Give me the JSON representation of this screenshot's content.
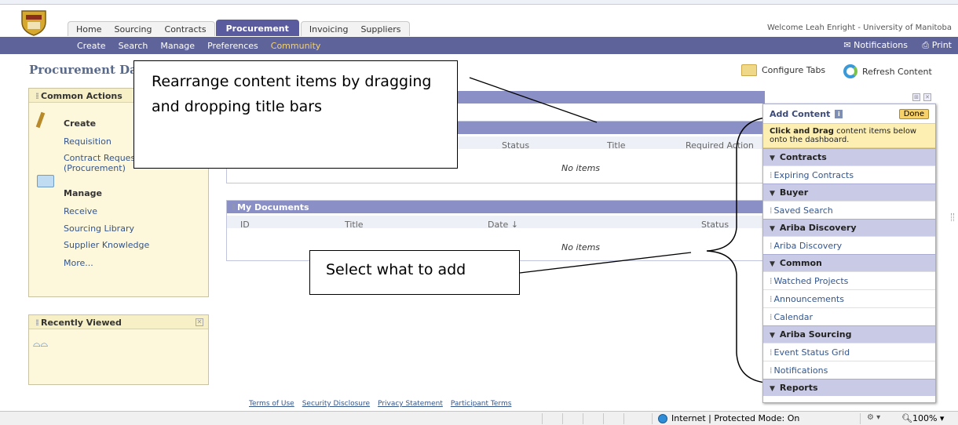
{
  "header": {
    "tabs": [
      "Home",
      "Sourcing",
      "Contracts",
      "Procurement",
      "Invoicing",
      "Suppliers"
    ],
    "active_tab": "Procurement",
    "welcome": "Welcome Leah Enright - University of Manitoba"
  },
  "subnav": {
    "items": [
      "Create",
      "Search",
      "Manage",
      "Preferences",
      "Community"
    ],
    "notifications": "Notifications",
    "print": "Print"
  },
  "page": {
    "title": "Procurement Da",
    "configure_tabs": "Configure Tabs",
    "refresh_content": "Refresh Content"
  },
  "common_actions": {
    "title": "Common Actions",
    "create_heading": "Create",
    "create_links": [
      "Requisition",
      "Contract Reques",
      "(Procurement)"
    ],
    "manage_heading": "Manage",
    "manage_links": [
      "Receive",
      "Sourcing Library",
      "Supplier Knowledge",
      "More..."
    ]
  },
  "recently_viewed": {
    "title": "Recently Viewed"
  },
  "requests_panel": {
    "columns": [
      "Status",
      "Title",
      "Required Action"
    ],
    "empty": "No items"
  },
  "documents_panel": {
    "title": "My Documents",
    "columns": [
      "ID",
      "Title",
      "Date ↓",
      "Status"
    ],
    "empty": "No items"
  },
  "callouts": {
    "drag": "Rearrange content items by dragging and dropping title bars",
    "select": "Select what to add"
  },
  "add_content": {
    "title": "Add Content",
    "done": "Done",
    "hint_bold": "Click and Drag",
    "hint_rest": "content items below onto the dashboard.",
    "groups": [
      {
        "category": "Contracts",
        "items": [
          "Expiring Contracts"
        ]
      },
      {
        "category": "Buyer",
        "items": [
          "Saved Search"
        ]
      },
      {
        "category": "Ariba Discovery",
        "items": [
          "Ariba Discovery"
        ]
      },
      {
        "category": "Common",
        "items": [
          "Watched Projects",
          "Announcements",
          "Calendar"
        ]
      },
      {
        "category": "Ariba Sourcing",
        "items": [
          "Event Status Grid",
          "Notifications"
        ]
      },
      {
        "category": "Reports",
        "items": []
      }
    ]
  },
  "footer": {
    "links": [
      "Terms of Use",
      "Security Disclosure",
      "Privacy Statement",
      "Participant Terms"
    ]
  },
  "statusbar": {
    "zone": "Internet | Protected Mode: On",
    "zoom": "100%"
  }
}
